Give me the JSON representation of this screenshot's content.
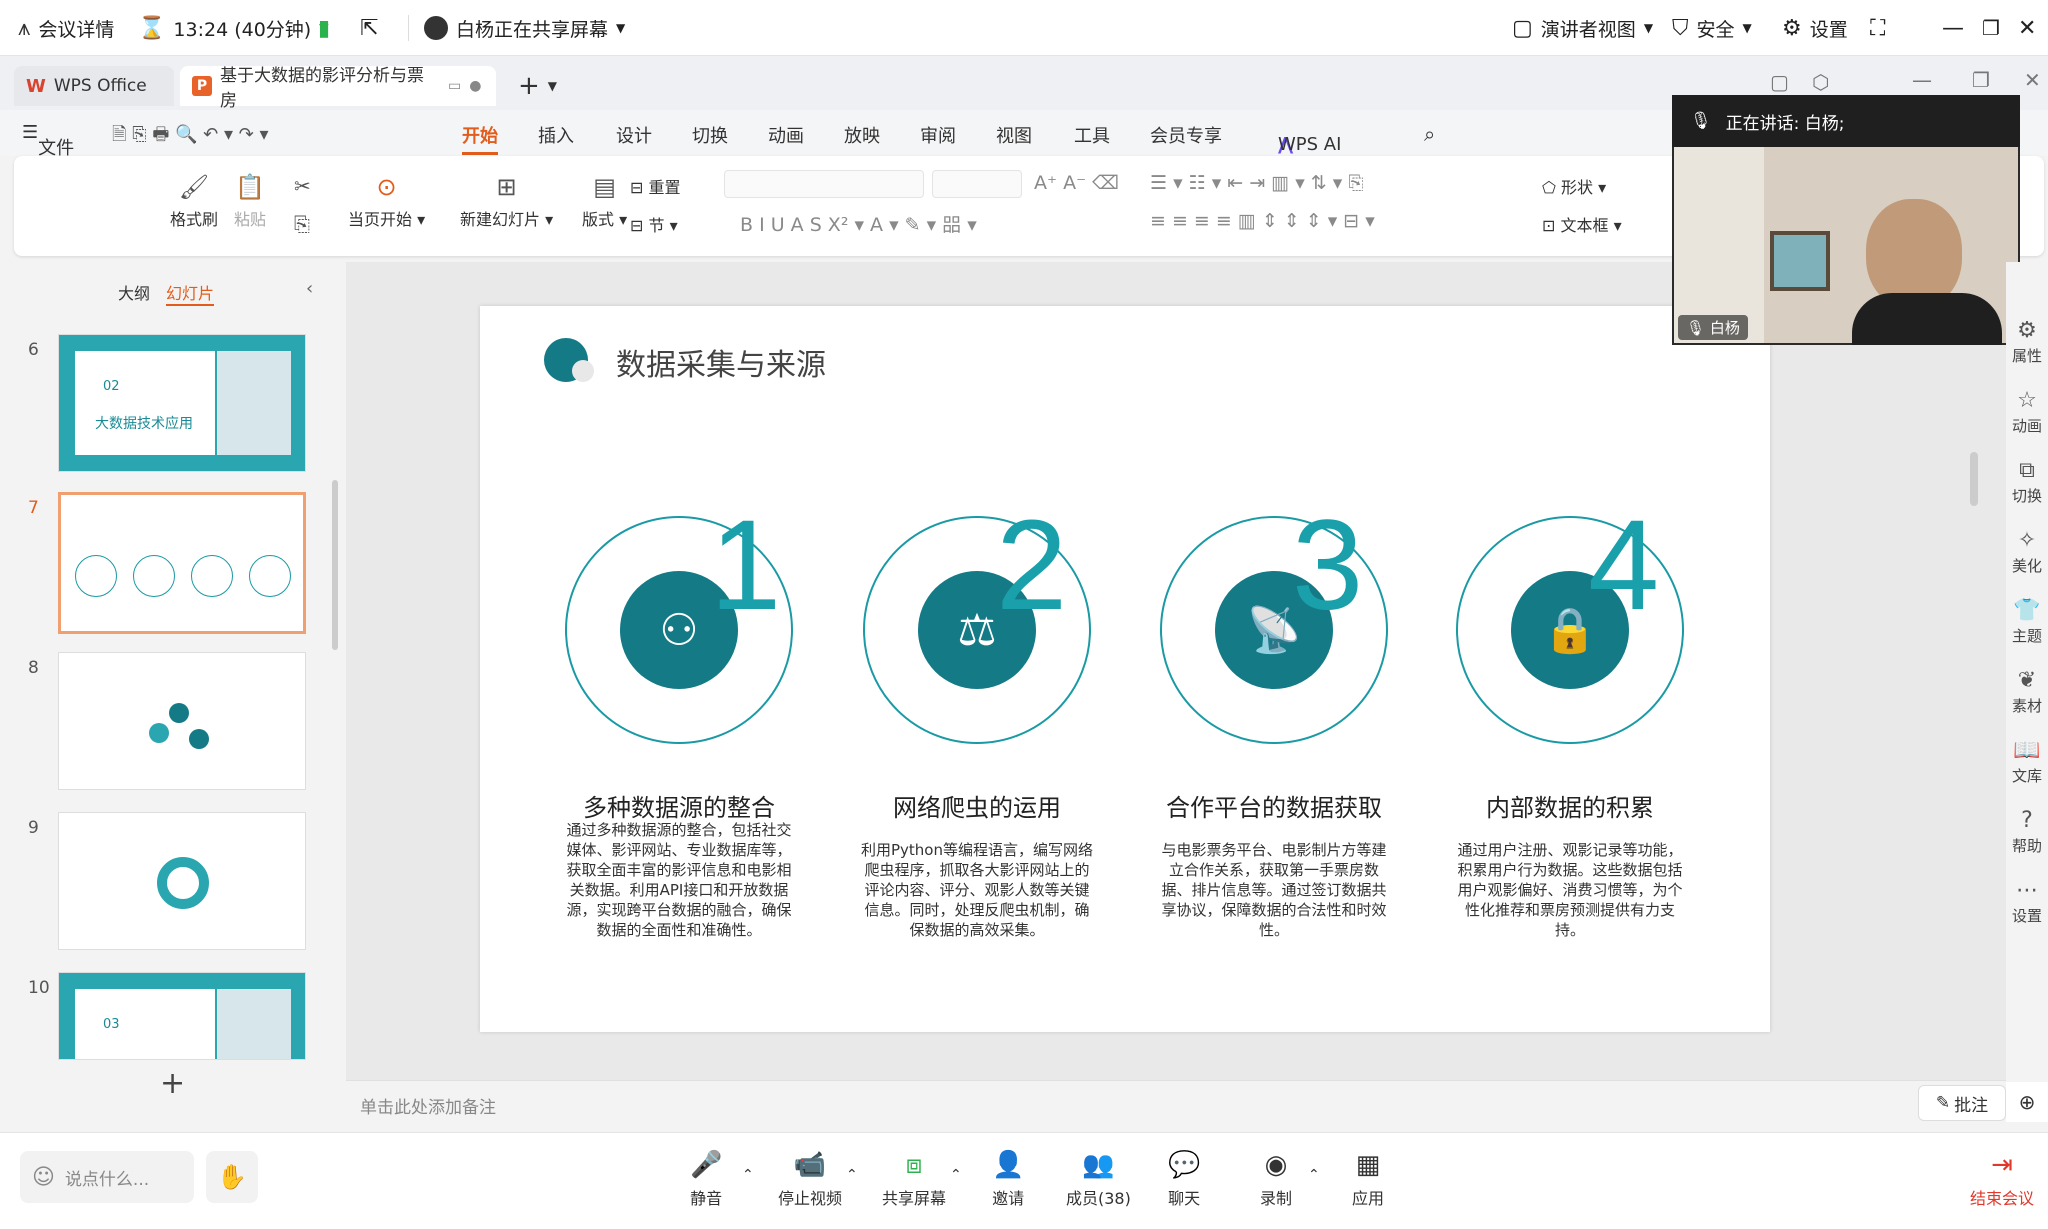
{
  "meeting_bar": {
    "details": "会议详情",
    "timer": "13:24 (40分钟)",
    "sharing": "白杨正在共享屏幕",
    "presenter_view": "演讲者视图",
    "security": "安全",
    "settings": "设置"
  },
  "tabs": {
    "home": "WPS Office",
    "document": "基于大数据的影评分析与票房"
  },
  "menu": {
    "file": "文件",
    "items": [
      "开始",
      "插入",
      "设计",
      "切换",
      "动画",
      "放映",
      "审阅",
      "视图",
      "工具",
      "会员专享"
    ],
    "ai": "WPS AI"
  },
  "ribbon": {
    "format_painter": "格式刷",
    "paste": "粘贴",
    "play_from_current": "当页开始",
    "new_slide": "新建幻灯片",
    "layout": "版式",
    "reset": "重置",
    "section": "节",
    "shape": "形状",
    "textbox": "文本框"
  },
  "left_panel": {
    "tab_outline": "大纲",
    "tab_slides": "幻灯片",
    "slides": [
      {
        "num": "6",
        "label_num": "02",
        "label": "大数据技术应用"
      },
      {
        "num": "7"
      },
      {
        "num": "8"
      },
      {
        "num": "9"
      },
      {
        "num": "10",
        "label_num": "03"
      }
    ],
    "add": "+"
  },
  "slide": {
    "title": "数据采集与来源",
    "features": [
      {
        "num": "1",
        "title": "多种数据源的整合",
        "desc": "通过多种数据源的整合，包括社交媒体、影评网站、专业数据库等，获取全面丰富的影评信息和电影相关数据。利用API接口和开放数据源，实现跨平台数据的融合，确保数据的全面性和准确性。"
      },
      {
        "num": "2",
        "title": "网络爬虫的运用",
        "desc": "利用Python等编程语言，编写网络爬虫程序，抓取各大影评网站上的评论内容、评分、观影人数等关键信息。同时，处理反爬虫机制，确保数据的高效采集。"
      },
      {
        "num": "3",
        "title": "合作平台的数据获取",
        "desc": "与电影票务平台、电影制片方等建立合作关系，获取第一手票房数据、排片信息等。通过签订数据共享协议，保障数据的合法性和时效性。"
      },
      {
        "num": "4",
        "title": "内部数据的积累",
        "desc": "通过用户注册、观影记录等功能，积累用户行为数据。这些数据包括用户观影偏好、消费习惯等，为个性化推荐和票房预测提供有力支持。"
      }
    ]
  },
  "right_sidebar": [
    "属性",
    "动画",
    "切换",
    "美化",
    "主题",
    "素材",
    "文库",
    "帮助",
    "设置"
  ],
  "notes": {
    "placeholder": "单击此处添加备注",
    "comment": "批注"
  },
  "video": {
    "speaking": "正在讲话:  白杨;",
    "name": "白杨"
  },
  "bottom_bar": {
    "chat_placeholder": "说点什么...",
    "mute": "静音",
    "stop_video": "停止视频",
    "share": "共享屏幕",
    "invite": "邀请",
    "members": "成员(38)",
    "chat": "聊天",
    "record": "录制",
    "apps": "应用",
    "end": "结束会议"
  },
  "colors": {
    "accent": "#137a86",
    "teal": "#1aa0ab",
    "wps_red": "#d9432f",
    "menu_active": "#e25d1c"
  }
}
